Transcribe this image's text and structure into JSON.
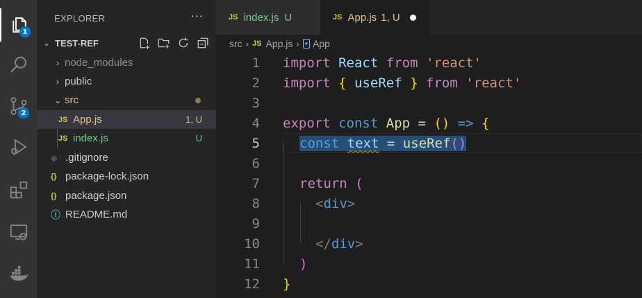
{
  "activity_bar": {
    "items": [
      {
        "icon": "files-icon",
        "badge": "1"
      },
      {
        "icon": "search-icon"
      },
      {
        "icon": "source-control-icon",
        "badge": "2"
      },
      {
        "icon": "run-debug-icon"
      },
      {
        "icon": "extensions-icon"
      },
      {
        "icon": "remote-explorer-icon"
      },
      {
        "icon": "docker-icon"
      }
    ]
  },
  "sidebar": {
    "title": "EXPLORER",
    "more": "···",
    "section_label": "TEST-REF",
    "tree": [
      {
        "name": "node_modules",
        "kind": "folder",
        "expanded": false
      },
      {
        "name": "public",
        "kind": "folder",
        "expanded": false
      },
      {
        "name": "src",
        "kind": "folder",
        "expanded": true
      },
      {
        "name": "App.js",
        "kind": "js",
        "status": "1, U",
        "selected": true
      },
      {
        "name": "index.js",
        "kind": "js",
        "status": "U"
      },
      {
        "name": ".gitignore",
        "kind": "git"
      },
      {
        "name": "package-lock.json",
        "kind": "json"
      },
      {
        "name": "package.json",
        "kind": "json"
      },
      {
        "name": "README.md",
        "kind": "info"
      }
    ]
  },
  "tabs": [
    {
      "file_icon": "JS",
      "label": "index.js",
      "status": "U",
      "active": false
    },
    {
      "file_icon": "JS",
      "label": "App.js",
      "status": "1, U",
      "active": true,
      "dirty": true
    }
  ],
  "breadcrumb": {
    "folder": "src",
    "file_icon": "JS",
    "file": "App.js",
    "symbol": "App"
  },
  "editor": {
    "current_line": 5,
    "lines": [
      {
        "n": "1"
      },
      {
        "n": "2"
      },
      {
        "n": "3"
      },
      {
        "n": "4"
      },
      {
        "n": "5"
      },
      {
        "n": "6"
      },
      {
        "n": "7"
      },
      {
        "n": "8"
      },
      {
        "n": "9"
      },
      {
        "n": "10"
      },
      {
        "n": "11"
      },
      {
        "n": "12"
      }
    ],
    "tokens": {
      "import": "import",
      "react_id": "React",
      "from": "from",
      "react_str": "'react'",
      "lbrace": "{",
      "rbrace": "}",
      "useRef": "useRef",
      "export": "export",
      "const": "const",
      "App": "App",
      "eq": "=",
      "parens": "()",
      "arrow": "=>",
      "text": "text",
      "call": "()",
      "return": "return",
      "lparen": "(",
      "rparen": ")",
      "div_open": "div",
      "div_close": "div",
      "lt": "<",
      "lt_slash": "</",
      "gt": ">"
    }
  },
  "colors": {
    "accent": "#007acc",
    "selection": "#264f78",
    "untracked": "#73c991",
    "modified_warning": "#e2c08d"
  }
}
